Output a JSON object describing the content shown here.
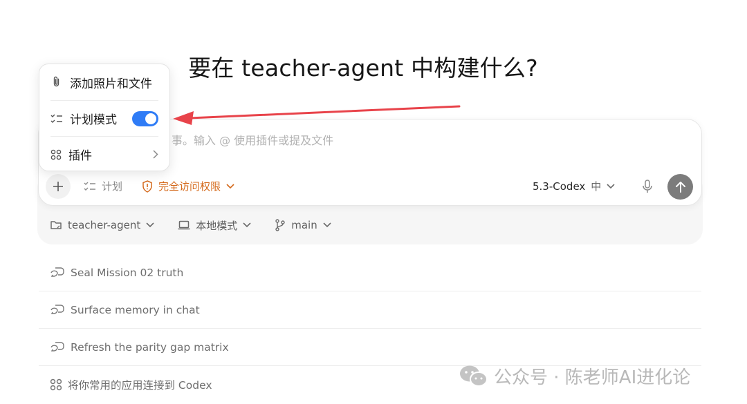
{
  "heading": "要在 teacher-agent 中构建什么?",
  "composer": {
    "placeholder_visible": "事。输入 @ 使用插件或提及文件",
    "plan_label": "计划",
    "access_label": "完全访问权限",
    "model_label": "5.3-Codex",
    "effort_label": "中"
  },
  "menu": {
    "items": [
      {
        "label": "添加照片和文件",
        "icon": "paperclip-icon"
      },
      {
        "label": "计划模式",
        "icon": "checklist-icon",
        "toggle_on": true
      },
      {
        "label": "插件",
        "icon": "grid-icon",
        "has_submenu": true
      }
    ]
  },
  "context": {
    "project": "teacher-agent",
    "mode": "本地模式",
    "branch": "main"
  },
  "tasks": [
    {
      "label": "Seal Mission 02 truth",
      "icon": "chat-bubble-icon"
    },
    {
      "label": "Surface memory in chat",
      "icon": "chat-bubble-icon"
    },
    {
      "label": "Refresh the parity gap matrix",
      "icon": "chat-bubble-icon"
    },
    {
      "label": "将你常用的应用连接到 Codex",
      "icon": "grid-icon"
    }
  ],
  "watermark": "公众号 · 陈老师AI进化论",
  "colors": {
    "accent": "#2f7cf6",
    "warning": "#d4691b",
    "annotation": "#e8434a",
    "send_button": "#7c7c7c"
  }
}
